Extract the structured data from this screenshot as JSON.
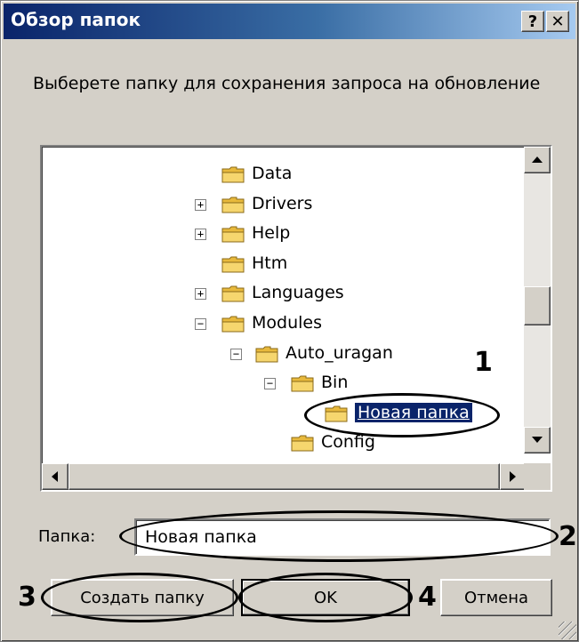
{
  "window": {
    "title": "Обзор папок",
    "help_label": "?",
    "close_label": "✕"
  },
  "prompt": "Выберете папку для сохранения запроса на обновление",
  "tree": {
    "items": [
      {
        "label": "Data",
        "expander": "",
        "level": 0
      },
      {
        "label": "Drivers",
        "expander": "+",
        "level": 0
      },
      {
        "label": "Help",
        "expander": "+",
        "level": 0
      },
      {
        "label": "Htm",
        "expander": "",
        "level": 0
      },
      {
        "label": "Languages",
        "expander": "+",
        "level": 0
      },
      {
        "label": "Modules",
        "expander": "−",
        "level": 0
      },
      {
        "label": "Auto_uragan",
        "expander": "−",
        "level": 1
      },
      {
        "label": "Bin",
        "expander": "−",
        "level": 2
      },
      {
        "label": "Новая папка",
        "expander": "",
        "level": 3,
        "selected": true
      },
      {
        "label": "Config",
        "expander": "",
        "level": 2
      }
    ]
  },
  "folder_field": {
    "label": "Папка:",
    "value": "Новая папка"
  },
  "buttons": {
    "create_folder": "Создать папку",
    "ok": "OK",
    "cancel": "Отмена"
  },
  "annotations": {
    "n1": "1",
    "n2": "2",
    "n3": "3",
    "n4": "4"
  },
  "colors": {
    "title_gradient_start": "#0a246a",
    "title_gradient_end": "#a6caf0",
    "dialog_bg": "#d4d0c8",
    "selection": "#0a246a"
  }
}
